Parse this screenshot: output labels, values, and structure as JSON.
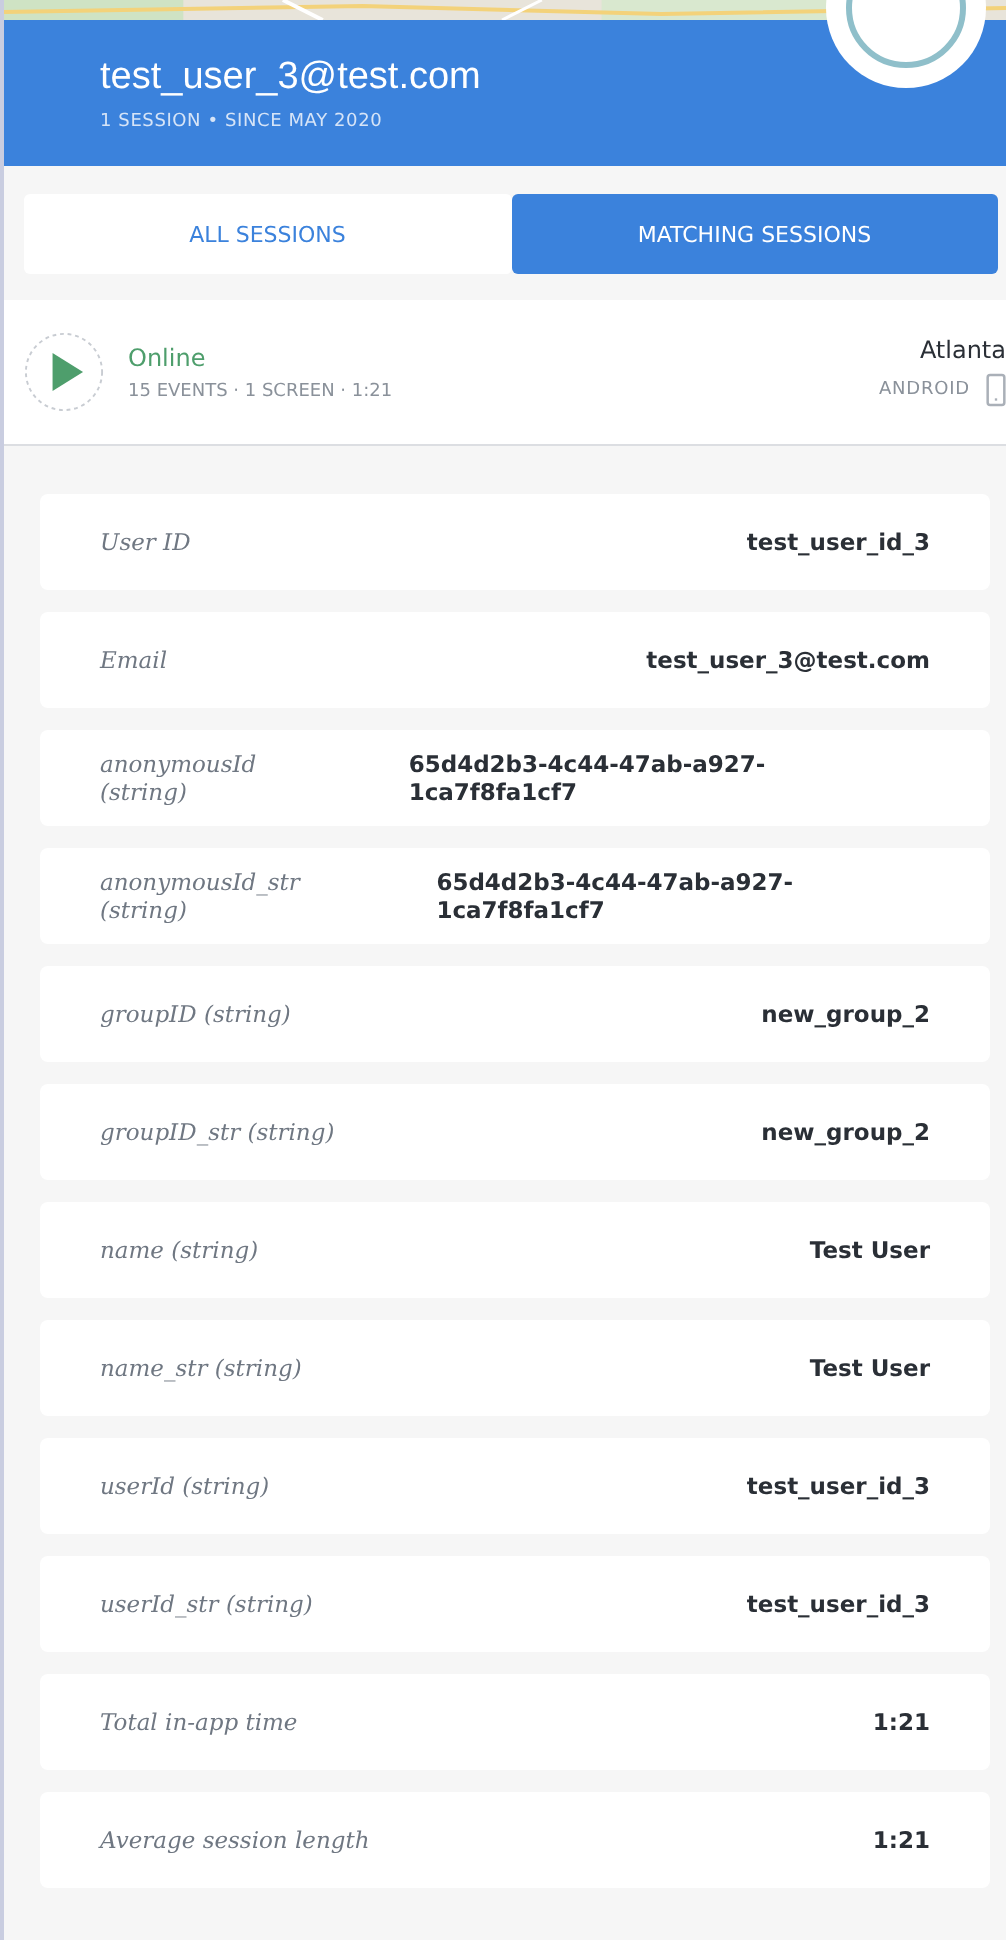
{
  "header": {
    "title": "test_user_3@test.com",
    "subtitle": "1 SESSION • SINCE MAY 2020"
  },
  "tabs": [
    {
      "label": "ALL SESSIONS",
      "selected": false
    },
    {
      "label": "MATCHING SESSIONS",
      "selected": true
    }
  ],
  "session": {
    "status": "Online",
    "details": "15 EVENTS · 1 SCREEN · 1:21",
    "city": "Atlanta",
    "platform": "ANDROID"
  },
  "attributes": [
    {
      "label": "User ID",
      "value": "test_user_id_3"
    },
    {
      "label": "Email",
      "value": "test_user_3@test.com"
    },
    {
      "label": "anonymousId (string)",
      "value": "65d4d2b3-4c44-47ab-a927-1ca7f8fa1cf7"
    },
    {
      "label": "anonymousId_str (string)",
      "value": "65d4d2b3-4c44-47ab-a927-1ca7f8fa1cf7"
    },
    {
      "label": "groupID (string)",
      "value": "new_group_2"
    },
    {
      "label": "groupID_str (string)",
      "value": "new_group_2"
    },
    {
      "label": "name (string)",
      "value": "Test User"
    },
    {
      "label": "name_str (string)",
      "value": "Test User"
    },
    {
      "label": "userId (string)",
      "value": "test_user_id_3"
    },
    {
      "label": "userId_str (string)",
      "value": "test_user_id_3"
    },
    {
      "label": "Total in-app time",
      "value": "1:21"
    },
    {
      "label": "Average session length",
      "value": "1:21"
    }
  ]
}
